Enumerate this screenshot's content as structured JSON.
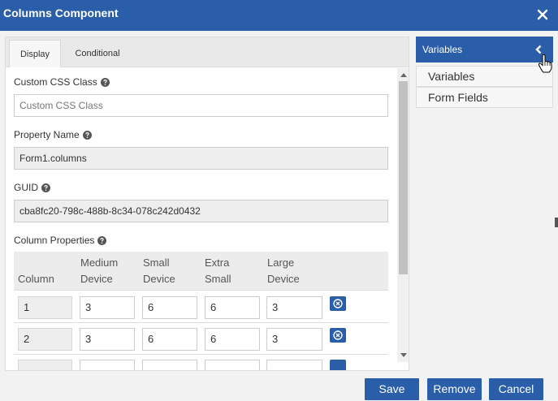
{
  "dialog": {
    "title": "Columns Component"
  },
  "tabs": [
    {
      "label": "Display"
    },
    {
      "label": "Conditional"
    }
  ],
  "form": {
    "css_class": {
      "label": "Custom CSS Class",
      "placeholder": "Custom CSS Class"
    },
    "property_name": {
      "label": "Property Name",
      "value": "Form1.columns"
    },
    "guid": {
      "label": "GUID",
      "value": "cba8fc20-798c-488b-8c34-078c242d0432"
    },
    "column_properties": {
      "label": "Column Properties",
      "headers": [
        "Column",
        "Medium\nDevice",
        "Small\nDevice",
        "Extra\nSmall",
        "Large\nDevice"
      ],
      "rows": [
        {
          "column": "1",
          "medium": "3",
          "small": "6",
          "extra_small": "6",
          "large": "3"
        },
        {
          "column": "2",
          "medium": "3",
          "small": "6",
          "extra_small": "6",
          "large": "3"
        }
      ]
    }
  },
  "sidebar": {
    "header": "Variables",
    "items": [
      {
        "label": "Variables"
      },
      {
        "label": "Form Fields"
      }
    ]
  },
  "buttons": {
    "save": "Save",
    "remove": "Remove",
    "cancel": "Cancel"
  },
  "colors": {
    "accent": "#2a5ea8"
  },
  "icons": {
    "close": "close-icon",
    "help": "help-icon",
    "remove_row": "remove-row-icon",
    "collapse": "chevron-left-icon",
    "cursor": "hand-cursor-icon"
  }
}
